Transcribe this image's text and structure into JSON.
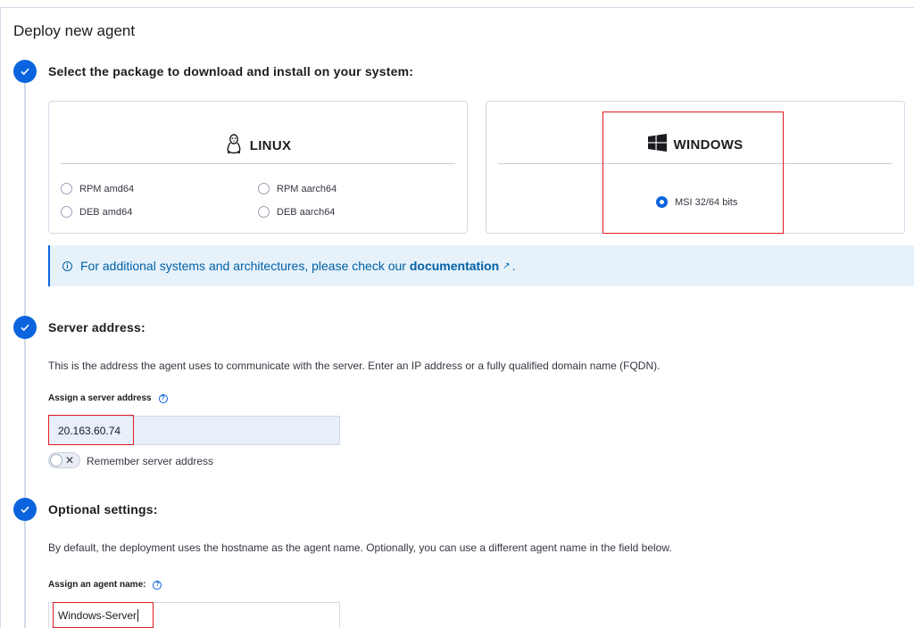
{
  "page": {
    "title": "Deploy new agent"
  },
  "steps": [
    {
      "title": "Select the package to download and install on your system:"
    },
    {
      "title": "Server address:"
    },
    {
      "title": "Optional settings:"
    }
  ],
  "linux": {
    "name": "LINUX",
    "options": [
      "RPM amd64",
      "RPM aarch64",
      "DEB amd64",
      "DEB aarch64"
    ]
  },
  "windows": {
    "name": "WINDOWS",
    "options": [
      "MSI 32/64 bits"
    ],
    "selected": "MSI 32/64 bits"
  },
  "callout": {
    "text": "For additional systems and architectures, please check our",
    "link": "documentation",
    "end": "."
  },
  "server": {
    "description": "This is the address the agent uses to communicate with the server. Enter an IP address or a fully qualified domain name (FQDN).",
    "label": "Assign a server address",
    "value": "20.163.60.74",
    "remember_label": "Remember server address"
  },
  "optional": {
    "description": "By default, the deployment uses the hostname as the agent name. Optionally, you can use a different agent name in the field below.",
    "label": "Assign an agent name:",
    "value": "Windows-Server"
  },
  "colors": {
    "accent": "#0b64dd",
    "highlight": "#e21b23",
    "callout_bg": "#e6f1fa"
  }
}
